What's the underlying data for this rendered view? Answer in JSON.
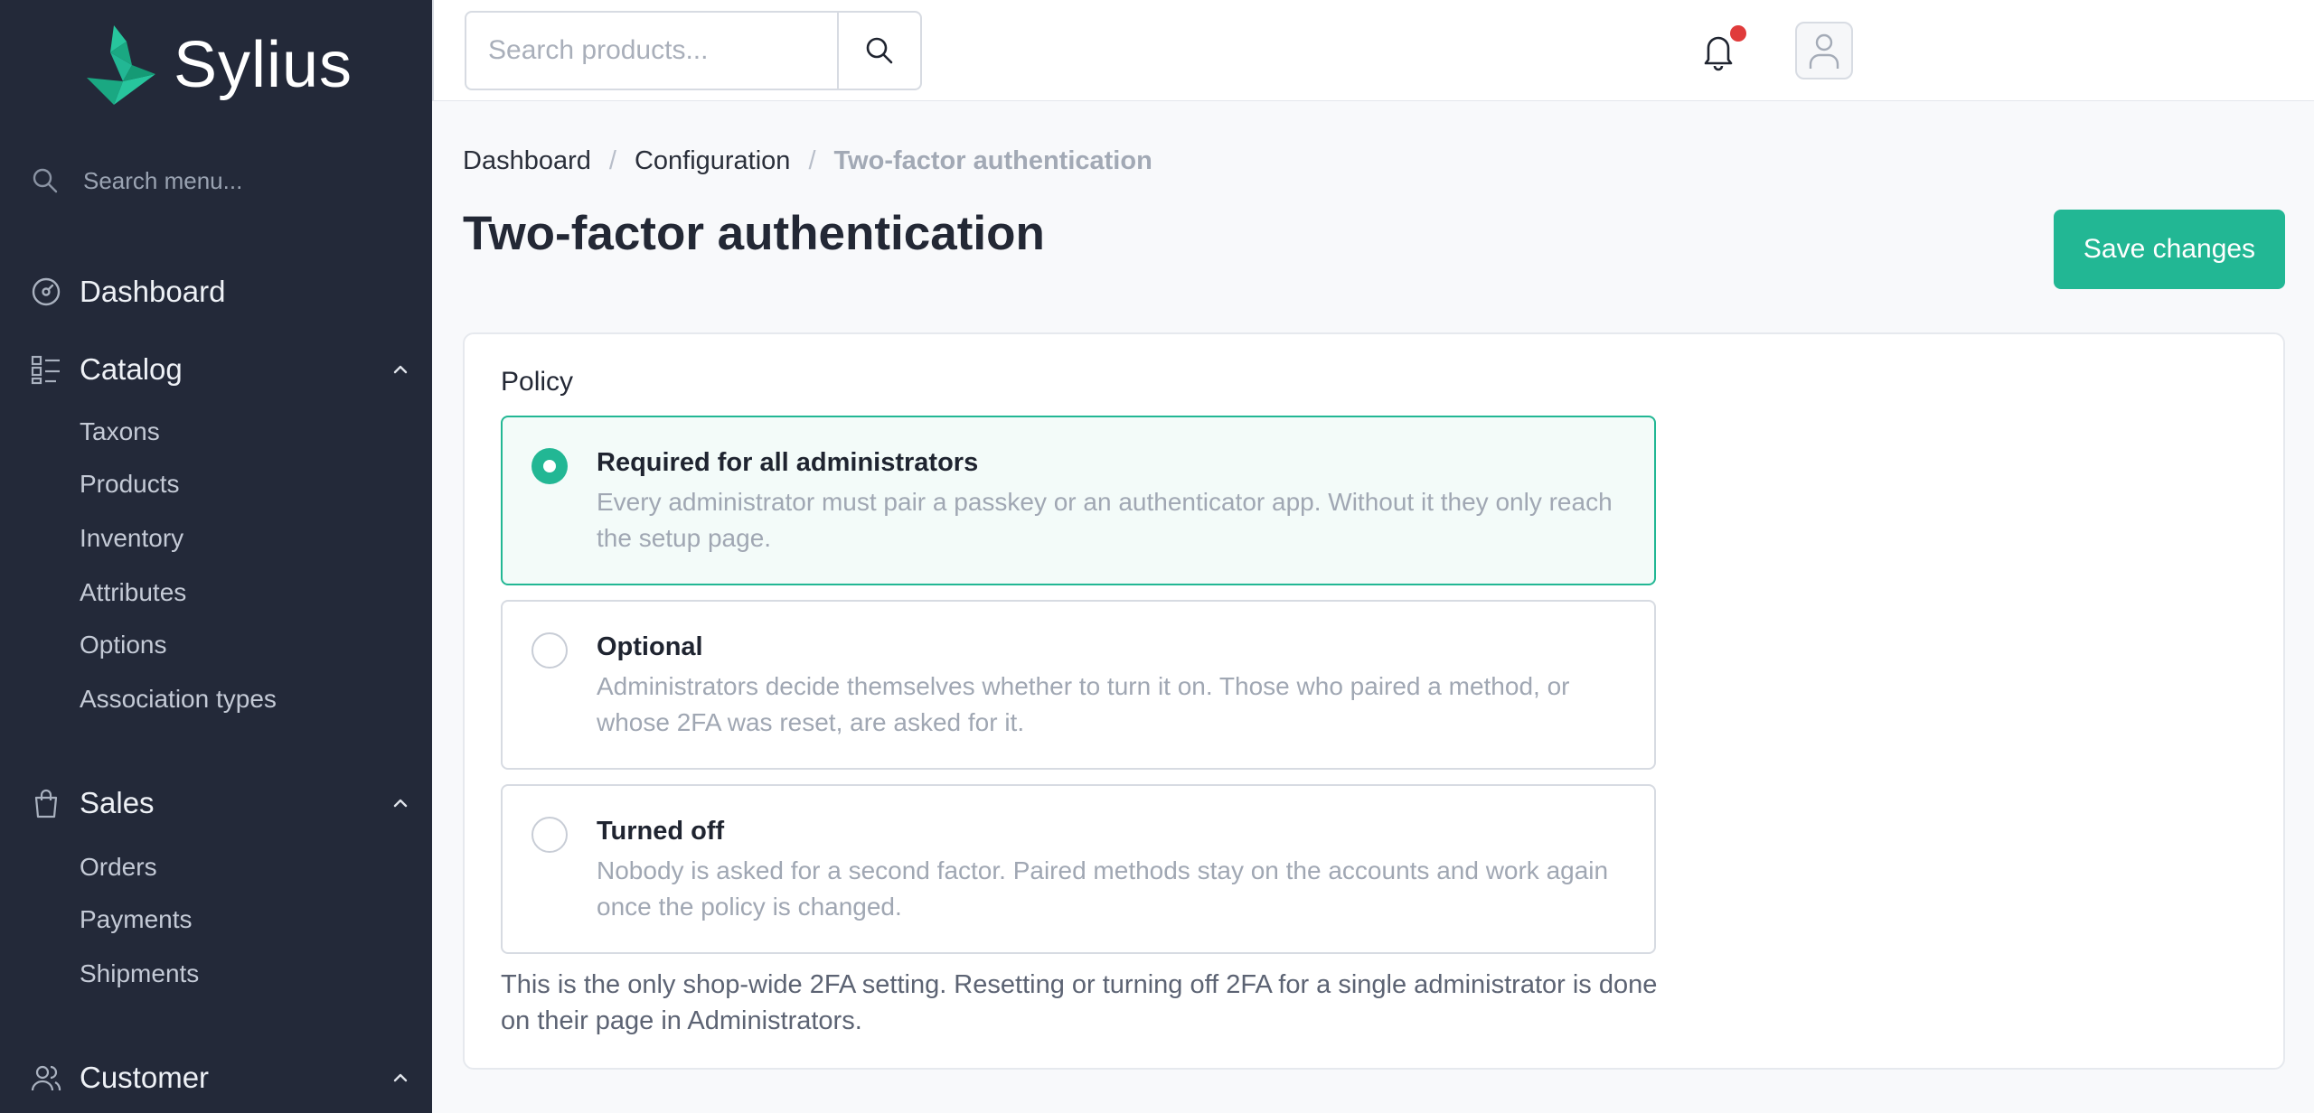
{
  "app": {
    "logo_text": "Sylius",
    "colors": {
      "accent": "#22b794",
      "sidebar_bg": "#232939",
      "notification": "#e03b3b"
    }
  },
  "sidebar": {
    "search_placeholder": "Search menu...",
    "dashboard": {
      "label": "Dashboard",
      "icon": "gauge-icon"
    },
    "catalog": {
      "label": "Catalog",
      "icon": "list-icon",
      "expanded": true,
      "items": [
        "Taxons",
        "Products",
        "Inventory",
        "Attributes",
        "Options",
        "Association types"
      ]
    },
    "sales": {
      "label": "Sales",
      "icon": "shopping-bag-icon",
      "expanded": true,
      "items": [
        "Orders",
        "Payments",
        "Shipments"
      ]
    },
    "customer": {
      "label": "Customer",
      "icon": "users-icon",
      "expanded": true
    }
  },
  "header": {
    "search_placeholder": "Search products...",
    "notifications": {
      "icon": "bell-icon",
      "has_unread": true
    },
    "user": {
      "icon": "user-icon"
    }
  },
  "breadcrumb": {
    "items": [
      "Dashboard",
      "Configuration"
    ],
    "current": "Two-factor authentication",
    "separator": "/"
  },
  "page": {
    "title": "Two-factor authentication",
    "save_label": "Save changes"
  },
  "policy": {
    "label": "Policy",
    "selected_index": 0,
    "options": [
      {
        "title": "Required for all administrators",
        "description": "Every administrator must pair a passkey or an authenticator app. Without it they only reach the setup page."
      },
      {
        "title": "Optional",
        "description": "Administrators decide themselves whether to turn it on. Those who paired a method, or whose 2FA was reset, are asked for it."
      },
      {
        "title": "Turned off",
        "description": "Nobody is asked for a second factor. Paired methods stay on the accounts and work again once the policy is changed."
      }
    ],
    "footnote": "This is the only shop-wide 2FA setting. Resetting or turning off 2FA for a single administrator is done on their page in Administrators."
  }
}
